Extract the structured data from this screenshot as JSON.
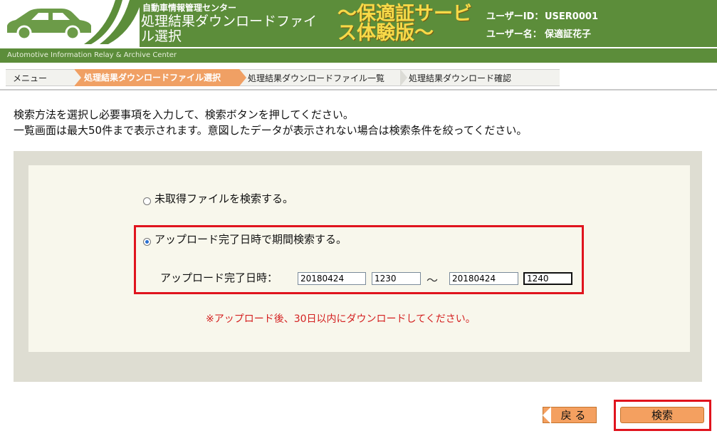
{
  "header": {
    "center_name": "自動車情報管理センター",
    "screen_title": "処理結果ダウンロードファイル選択",
    "trial_banner": "～保適証サービス体験版～",
    "user_id_label": "ユーザーID：",
    "user_id_value": "USER0001",
    "user_name_label": "ユーザー名：",
    "user_name_value": "保適証花子",
    "subtitle": "Automotive Information Relay & Archive Center"
  },
  "breadcrumb": [
    {
      "label": "メニュー",
      "state": "normal"
    },
    {
      "label": "処理結果ダウンロードファイル選択",
      "state": "active"
    },
    {
      "label": "処理結果ダウンロードファイル一覧",
      "state": "normal"
    },
    {
      "label": "処理結果ダウンロード確認",
      "state": "normal"
    }
  ],
  "instructions": {
    "line1": "検索方法を選択し必要事項を入力して、検索ボタンを押してください。",
    "line2": "一覧画面は最大50件まで表示されます。意図したデータが表示されない場合は検索条件を絞ってください。"
  },
  "search": {
    "option_untaken": "未取得ファイルを検索する。",
    "option_period": "アップロード完了日時で期間検索する。",
    "selected_option": "period",
    "period_label": "アップロード完了日時：",
    "from_date": "20180424",
    "from_time": "1230",
    "separator": "～",
    "to_date": "20180424",
    "to_time": "1240",
    "note": "※アップロード後、30日以内にダウンロードしてください。"
  },
  "actions": {
    "back_label": "戻 る",
    "search_label": "検索"
  },
  "colors": {
    "header_green": "#5c8d3a",
    "breadcrumb_active": "#f0a064",
    "highlight_red": "#e0141e",
    "note_red": "#d42020",
    "button_orange": "#f4a060"
  }
}
